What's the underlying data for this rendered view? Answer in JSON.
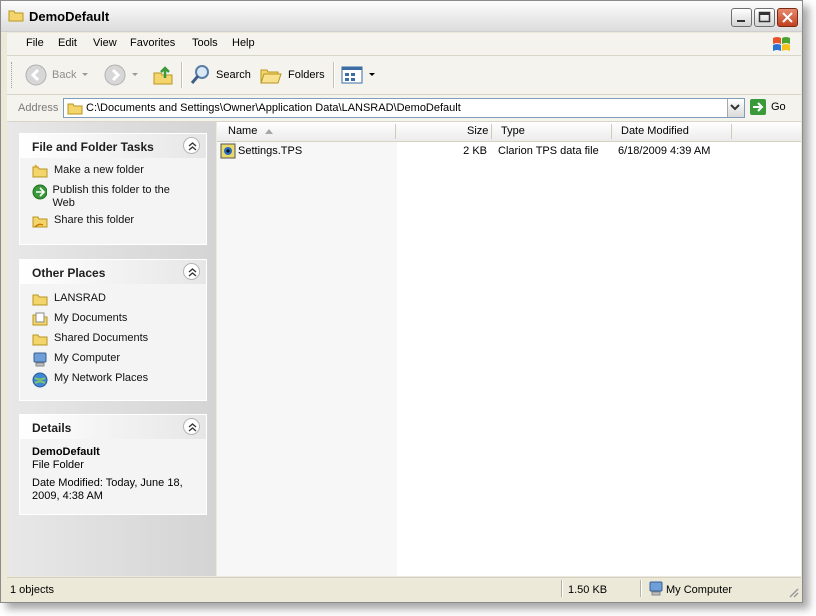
{
  "window": {
    "title": "DemoDefault"
  },
  "menu": [
    "File",
    "Edit",
    "View",
    "Favorites",
    "Tools",
    "Help"
  ],
  "toolbar": {
    "back": "Back",
    "search": "Search",
    "folders": "Folders"
  },
  "address": {
    "label": "Address",
    "path": "C:\\Documents and Settings\\Owner\\Application Data\\LANSRAD\\DemoDefault",
    "go": "Go"
  },
  "file_tasks": {
    "title": "File and Folder Tasks",
    "items": [
      {
        "label": "Make a new folder",
        "icon": "new-folder-icon"
      },
      {
        "label": "Publish this folder to the Web",
        "icon": "publish-web-icon"
      },
      {
        "label": "Share this folder",
        "icon": "share-folder-icon"
      }
    ]
  },
  "other_places": {
    "title": "Other Places",
    "items": [
      {
        "label": "LANSRAD",
        "icon": "folder-icon"
      },
      {
        "label": "My Documents",
        "icon": "my-documents-icon"
      },
      {
        "label": "Shared Documents",
        "icon": "folder-icon"
      },
      {
        "label": "My Computer",
        "icon": "my-computer-icon"
      },
      {
        "label": "My Network Places",
        "icon": "network-places-icon"
      }
    ]
  },
  "details": {
    "title": "Details",
    "name": "DemoDefault",
    "type": "File Folder",
    "modified": "Date Modified: Today, June 18, 2009, 4:38 AM"
  },
  "columns": {
    "name": "Name",
    "size": "Size",
    "type": "Type",
    "date": "Date Modified"
  },
  "files": [
    {
      "name": "Settings.TPS",
      "size": "2 KB",
      "type": "Clarion TPS data file",
      "date": "6/18/2009 4:39 AM"
    }
  ],
  "status": {
    "objects": "1 objects",
    "size": "1.50 KB",
    "location": "My Computer"
  },
  "colors": {
    "panel_title": "#1e1e1e",
    "address_border": "#7f9db9",
    "go_green": "#3a9a3a"
  }
}
